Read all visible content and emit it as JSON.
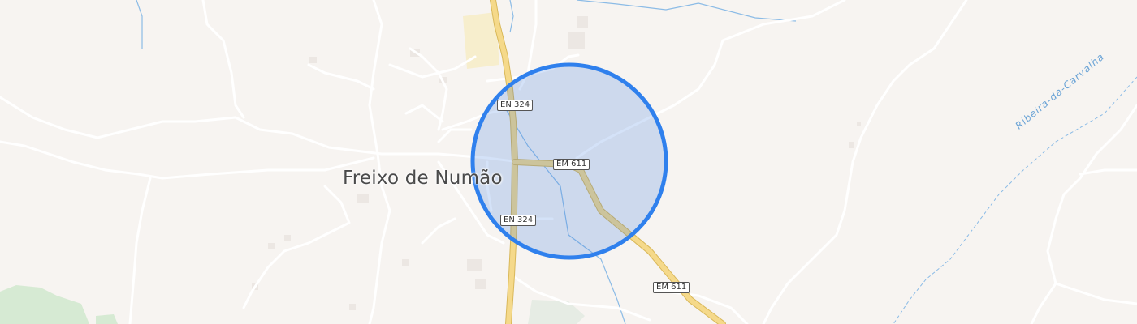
{
  "map": {
    "place_label": "Freixo de Numão",
    "stream_label": "Ribeira-da-Carvalha",
    "road_shields": [
      "EN 324",
      "EM 611",
      "EN 324",
      "EM 611"
    ],
    "colors": {
      "background": "#f7f4f1",
      "minor_road": "#ffffff",
      "major_road": "#f5d98a",
      "water": "#8bbbe6",
      "accuracy_circle_fill": "#3b7ddd",
      "accuracy_circle_stroke": "#2f80ed",
      "vegetation": "#d6ead3"
    }
  }
}
